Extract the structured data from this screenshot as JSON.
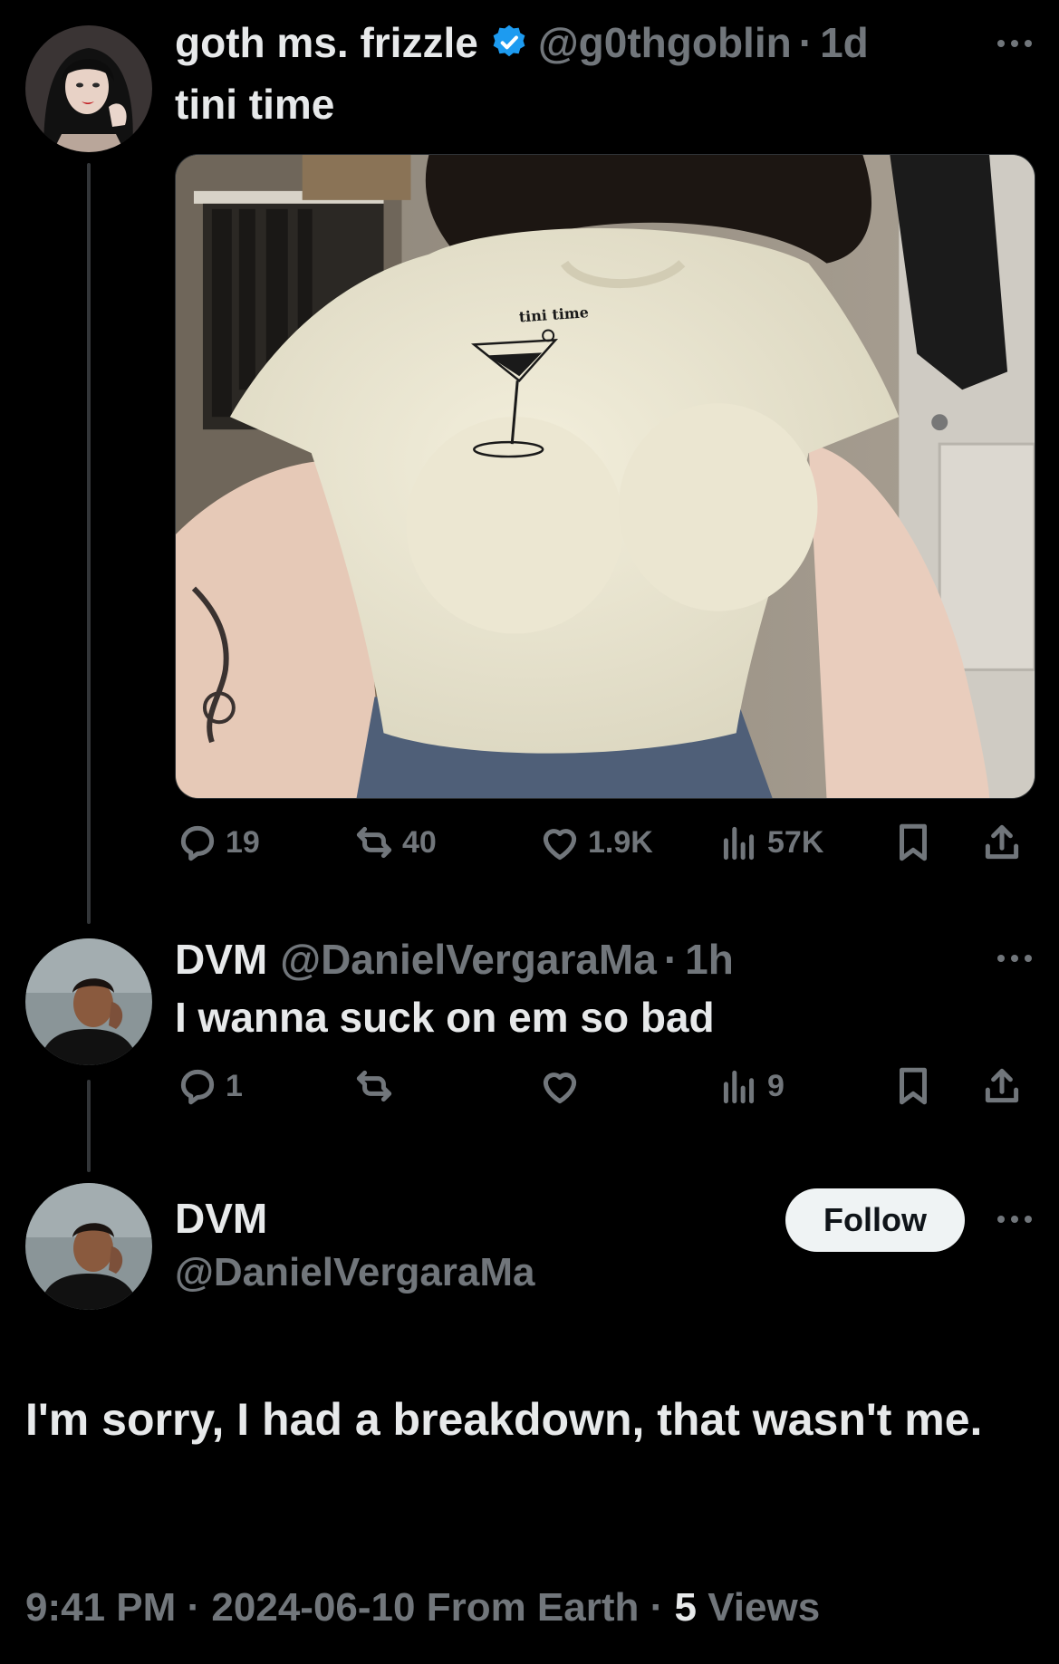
{
  "tweet1": {
    "display_name": "goth ms. frizzle",
    "handle": "@g0thgoblin",
    "separator": "·",
    "time": "1d",
    "text": "tini time",
    "shirt_text": "tini time",
    "actions": {
      "replies": "19",
      "reposts": "40",
      "likes": "1.9K",
      "views": "57K"
    }
  },
  "tweet2": {
    "display_name": "DVM",
    "handle": "@DanielVergaraMa",
    "separator": "·",
    "time": "1h",
    "text": "I wanna suck on em so bad",
    "actions": {
      "replies": "1",
      "reposts": "",
      "likes": "",
      "views": "9"
    }
  },
  "main_tweet": {
    "display_name": "DVM",
    "handle": "@DanielVergaraMa",
    "follow_label": "Follow",
    "text": "I'm sorry, I had a breakdown, that wasn't me.",
    "meta": {
      "time": "9:41 PM",
      "sep1": " · ",
      "date": "2024-06-10",
      "source": " From Earth",
      "sep2": " · ",
      "views_count": "5",
      "views_label": " Views"
    }
  },
  "colors": {
    "background": "#000000",
    "text": "#e7e9ea",
    "muted": "#71767b",
    "verified": "#1d9bf0",
    "follow_bg": "#eff3f4"
  }
}
